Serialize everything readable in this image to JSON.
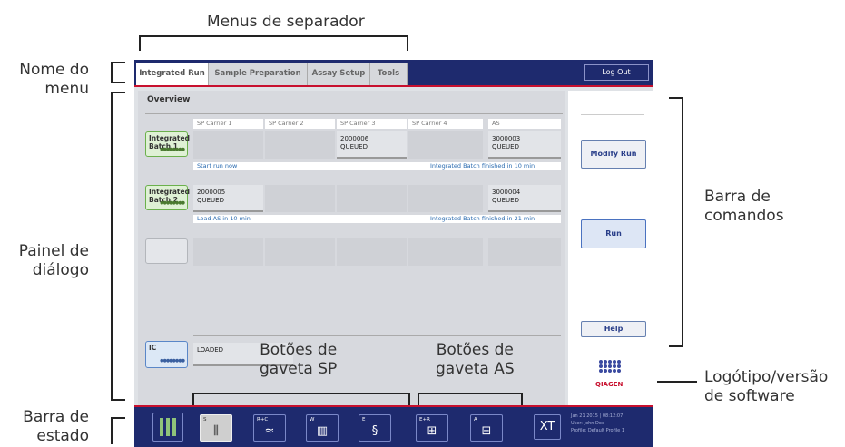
{
  "callouts": {
    "tab_menus": "Menus de separador",
    "menu_name": [
      "Nome do",
      "menu"
    ],
    "dialog_panel": [
      "Painel de",
      "diálogo"
    ],
    "status_bar": [
      "Barra de",
      "estado"
    ],
    "command_bar": [
      "Barra de",
      "comandos"
    ],
    "logo_version": [
      "Logótipo/versão",
      "de software"
    ],
    "sp_drawer_buttons": [
      "Botões de",
      "gaveta SP"
    ],
    "as_drawer_buttons": [
      "Botões de",
      "gaveta AS"
    ]
  },
  "tabs": [
    "Integrated Run",
    "Sample Preparation",
    "Assay Setup",
    "Tools"
  ],
  "logout_label": "Log Out",
  "overview_title": "Overview",
  "carrier_headers": [
    "SP Carrier 1",
    "SP Carrier 2",
    "SP Carrier 3",
    "SP Carrier 4",
    "AS"
  ],
  "batch1": {
    "label": [
      "Integrated",
      "Batch 1"
    ],
    "sp3": [
      "2000006",
      "QUEUED"
    ],
    "as": [
      "3000003",
      "QUEUED"
    ],
    "start_info": "Start run now",
    "finish_info": "Integrated Batch finished in 10 min"
  },
  "batch2": {
    "label": [
      "Integrated",
      "Batch 2"
    ],
    "sp1": [
      "2000005",
      "QUEUED"
    ],
    "as": [
      "3000004",
      "QUEUED"
    ],
    "start_info": "Load AS in 10 min",
    "finish_info": "Integrated Batch finished in 21 min"
  },
  "ic": {
    "label": "IC",
    "status": "LOADED"
  },
  "commands": {
    "modify": "Modify Run",
    "run": "Run",
    "help": "Help"
  },
  "logo_text": "QIAGEN",
  "status_buttons": [
    {
      "label": "S",
      "icon": "sample-rack-icon"
    },
    {
      "label": "R+C",
      "icon": "reagent-cartridge-icon"
    },
    {
      "label": "W",
      "icon": "waste-bin-icon"
    },
    {
      "label": "E",
      "icon": "eluate-icon"
    },
    {
      "label": "E+R",
      "icon": "eluate-reagent-icon"
    },
    {
      "label": "A",
      "icon": "assay-icon"
    }
  ],
  "status_info": {
    "date": "Jan 21 2015 | 08:12:07",
    "user_label": "User:",
    "user": "John Doe",
    "profile_label": "Profile:",
    "profile": "Default Profile 1"
  },
  "colors": {
    "brand_navy": "#1e2a6e",
    "accent_red": "#c8102e",
    "batch_green": "#6bb04c",
    "ic_blue": "#5a87c8"
  }
}
